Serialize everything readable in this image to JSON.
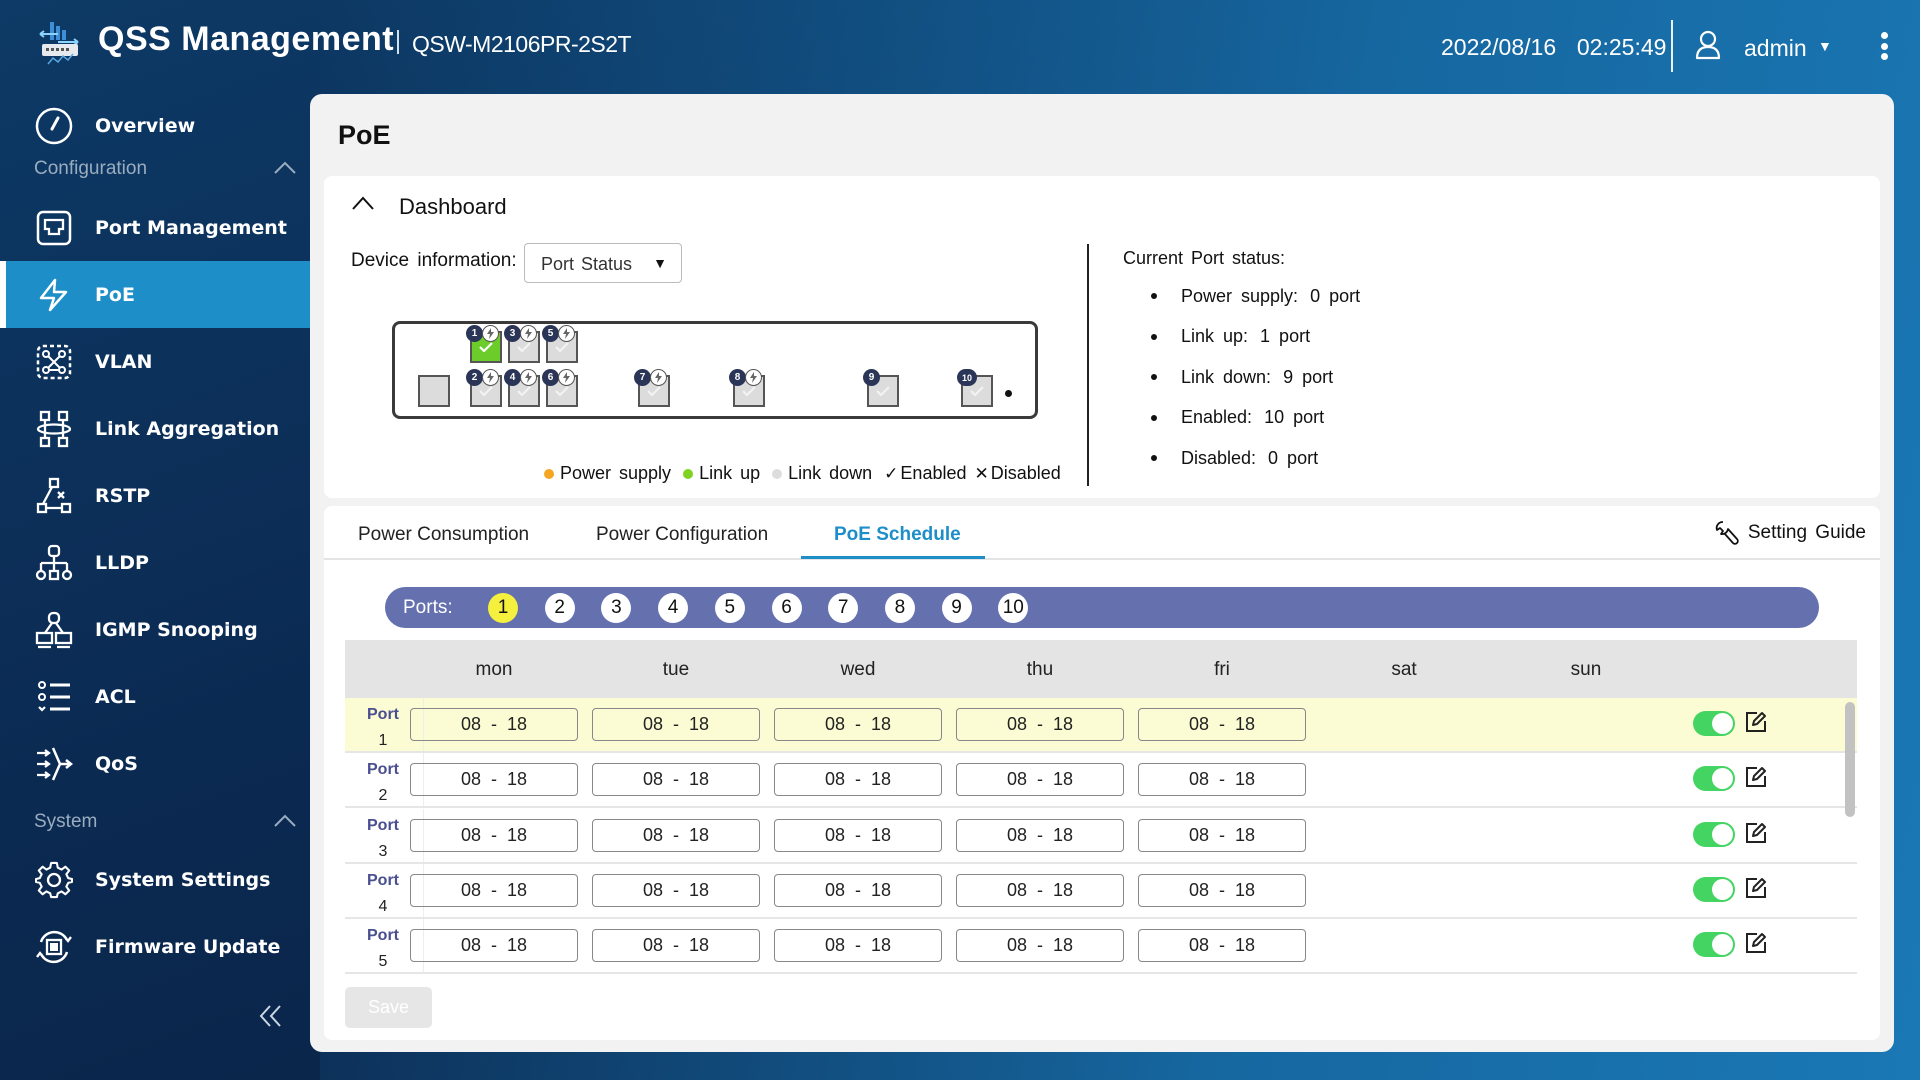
{
  "header": {
    "app_title": "QSS Management",
    "model": "QSW-M2106PR-2S2T",
    "datetime": "2022/08/16  02:25:49",
    "user": "admin"
  },
  "sidebar": {
    "overview": "Overview",
    "section_configuration": "Configuration",
    "items": [
      {
        "label": "Port Management",
        "icon": "port-icon"
      },
      {
        "label": "PoE",
        "icon": "lightning-icon",
        "active": true
      },
      {
        "label": "VLAN",
        "icon": "vlan-icon"
      },
      {
        "label": "Link Aggregation",
        "icon": "link-aggregation-icon"
      },
      {
        "label": "RSTP",
        "icon": "rstp-icon"
      },
      {
        "label": "LLDP",
        "icon": "lldp-icon"
      },
      {
        "label": "IGMP Snooping",
        "icon": "igmp-icon"
      },
      {
        "label": "ACL",
        "icon": "acl-icon"
      },
      {
        "label": "QoS",
        "icon": "qos-icon"
      }
    ],
    "section_system": "System",
    "system_items": [
      {
        "label": "System Settings",
        "icon": "gear-icon"
      },
      {
        "label": "Firmware Update",
        "icon": "firmware-update-icon"
      }
    ]
  },
  "page": {
    "title": "PoE"
  },
  "dashboard": {
    "title": "Dashboard",
    "device_info_label": "Device information:",
    "device_info_value": "Port Status",
    "ports": [
      {
        "n": "1",
        "state": "link-up",
        "poe": true
      },
      {
        "n": "2",
        "state": "link-down",
        "poe": true
      },
      {
        "n": "3",
        "state": "link-down",
        "poe": true
      },
      {
        "n": "4",
        "state": "link-down",
        "poe": true
      },
      {
        "n": "5",
        "state": "link-down",
        "poe": true
      },
      {
        "n": "6",
        "state": "link-down",
        "poe": true
      },
      {
        "n": "7",
        "state": "link-down",
        "poe": true
      },
      {
        "n": "8",
        "state": "link-down",
        "poe": true
      },
      {
        "n": "9",
        "state": "link-down",
        "poe": false
      },
      {
        "n": "10",
        "state": "link-down",
        "poe": false
      }
    ],
    "legend": {
      "power_supply": "Power supply",
      "link_up": "Link up",
      "link_down": "Link down",
      "enabled": "Enabled",
      "disabled": "Disabled",
      "enabled_symbol": "✓",
      "disabled_symbol": "✕"
    },
    "colors": {
      "power_supply": "#f5a623",
      "link_up": "#7ed321",
      "link_down": "#dddddd"
    },
    "status_title": "Current Port status:",
    "status": [
      {
        "label": "Power supply:",
        "value": "0 port"
      },
      {
        "label": "Link up:",
        "value": "1 port"
      },
      {
        "label": "Link down:",
        "value": "9 port"
      },
      {
        "label": "Enabled:",
        "value": "10 port"
      },
      {
        "label": "Disabled:",
        "value": "0 port"
      }
    ]
  },
  "tabs": {
    "items": [
      "Power Consumption",
      "Power Configuration",
      "PoE Schedule"
    ],
    "active": "PoE Schedule",
    "setting_guide": "Setting Guide"
  },
  "schedule": {
    "ports_label": "Ports:",
    "port_buttons": [
      "1",
      "2",
      "3",
      "4",
      "5",
      "6",
      "7",
      "8",
      "9",
      "10"
    ],
    "selected_port": "1",
    "days": [
      "mon",
      "tue",
      "wed",
      "thu",
      "fri",
      "sat",
      "sun"
    ],
    "port_label": "Port",
    "rows": [
      {
        "port": "1",
        "mon": "08 - 18",
        "tue": "08 - 18",
        "wed": "08 - 18",
        "thu": "08 - 18",
        "fri": "08 - 18",
        "sat": "",
        "sun": "",
        "enabled": true
      },
      {
        "port": "2",
        "mon": "08 - 18",
        "tue": "08 - 18",
        "wed": "08 - 18",
        "thu": "08 - 18",
        "fri": "08 - 18",
        "sat": "",
        "sun": "",
        "enabled": true
      },
      {
        "port": "3",
        "mon": "08 - 18",
        "tue": "08 - 18",
        "wed": "08 - 18",
        "thu": "08 - 18",
        "fri": "08 - 18",
        "sat": "",
        "sun": "",
        "enabled": true
      },
      {
        "port": "4",
        "mon": "08 - 18",
        "tue": "08 - 18",
        "wed": "08 - 18",
        "thu": "08 - 18",
        "fri": "08 - 18",
        "sat": "",
        "sun": "",
        "enabled": true
      },
      {
        "port": "5",
        "mon": "08 - 18",
        "tue": "08 - 18",
        "wed": "08 - 18",
        "thu": "08 - 18",
        "fri": "08 - 18",
        "sat": "",
        "sun": "",
        "enabled": true
      }
    ],
    "save_label": "Save"
  }
}
